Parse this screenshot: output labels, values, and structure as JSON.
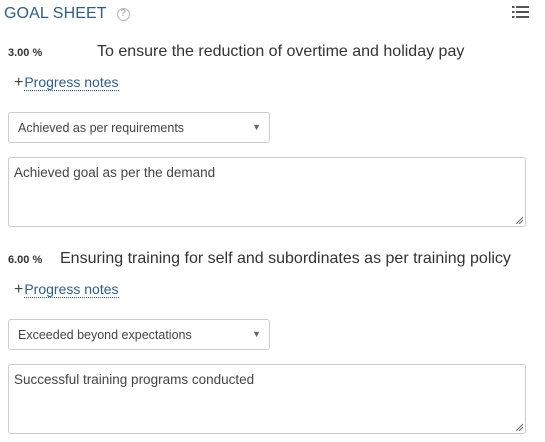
{
  "header": {
    "title": "GOAL SHEET",
    "help_icon": "?"
  },
  "icons": {
    "help": "question-circle-icon",
    "list": "list-icon",
    "plus": "plus-icon",
    "dropdown": "caret-down-icon"
  },
  "goals": [
    {
      "weight": "3.00 %",
      "description": "To ensure the reduction of overtime and holiday pay",
      "progress_plus": "+",
      "progress_label": "Progress notes",
      "rating": "Achieved as per requirements",
      "comment": "Achieved goal as per the demand"
    },
    {
      "weight": "6.00 %",
      "description": "Ensuring training for self and subordinates as per training policy",
      "progress_plus": "+",
      "progress_label": "Progress notes",
      "rating": "Exceeded beyond expectations",
      "comment": "Successful training programs conducted"
    }
  ],
  "colors": {
    "title": "#2f5d8a",
    "link": "#2f5d8a",
    "text": "#333333",
    "border": "#cccccc"
  }
}
